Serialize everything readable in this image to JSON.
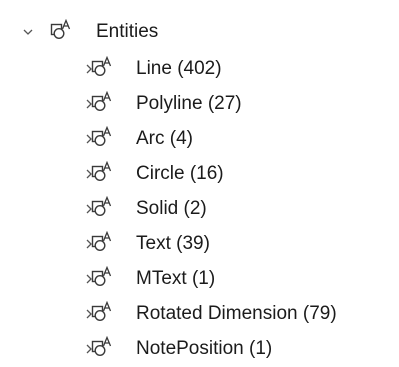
{
  "tree": {
    "root": {
      "label": "Entities",
      "expanded": true,
      "icon": "entity-icon"
    },
    "children": [
      {
        "label": "Line (402)",
        "expanded": false,
        "icon": "entity-icon"
      },
      {
        "label": "Polyline (27)",
        "expanded": false,
        "icon": "entity-icon"
      },
      {
        "label": "Arc (4)",
        "expanded": false,
        "icon": "entity-icon"
      },
      {
        "label": "Circle (16)",
        "expanded": false,
        "icon": "entity-icon"
      },
      {
        "label": "Solid (2)",
        "expanded": false,
        "icon": "entity-icon"
      },
      {
        "label": "Text (39)",
        "expanded": false,
        "icon": "entity-icon"
      },
      {
        "label": "MText (1)",
        "expanded": false,
        "icon": "entity-icon"
      },
      {
        "label": "Rotated Dimension (79)",
        "expanded": false,
        "icon": "entity-icon"
      },
      {
        "label": "NotePosition (1)",
        "expanded": false,
        "icon": "entity-icon"
      }
    ]
  },
  "colors": {
    "text": "#1b1b1b",
    "icon_stroke": "#3a3a3a",
    "chevron": "#555555",
    "background": "#ffffff"
  }
}
